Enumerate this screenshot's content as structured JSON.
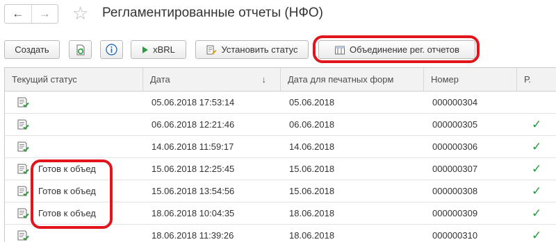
{
  "window": {
    "title": "Регламентированные отчеты (НФО)",
    "nav_back_icon": "arrow-left-icon",
    "nav_forward_icon": "arrow-right-icon",
    "favorite_icon": "star-icon"
  },
  "toolbar": {
    "create_label": "Создать",
    "xbrl_label": "xBRL",
    "set_status_label": "Установить статус",
    "merge_label": "Объединение рег. отчетов"
  },
  "table": {
    "columns": [
      "Текущий статус",
      "Дата",
      "Дата для печатных форм",
      "Номер",
      "Р."
    ],
    "sort_indicator": "↓",
    "rows": [
      {
        "status": "",
        "date": "05.06.2018 17:53:14",
        "print_date": "05.06.2018",
        "number": "000000304",
        "r": ""
      },
      {
        "status": "",
        "date": "06.06.2018 12:21:46",
        "print_date": "06.06.2018",
        "number": "000000305",
        "r": "✓"
      },
      {
        "status": "",
        "date": "14.06.2018 11:59:17",
        "print_date": "14.06.2018",
        "number": "000000306",
        "r": "✓"
      },
      {
        "status": "Готов к объед",
        "date": "15.06.2018 12:25:45",
        "print_date": "15.06.2018",
        "number": "000000307",
        "r": "✓"
      },
      {
        "status": "Готов к объед",
        "date": "15.06.2018 13:54:56",
        "print_date": "15.06.2018",
        "number": "000000308",
        "r": "✓"
      },
      {
        "status": "Готов к объед",
        "date": "18.06.2018 10:04:35",
        "print_date": "18.06.2018",
        "number": "000000309",
        "r": "✓"
      },
      {
        "status": "",
        "date": "18.06.2018 11:39:26",
        "print_date": "18.06.2018",
        "number": "000000310",
        "r": "✓"
      }
    ]
  },
  "colors": {
    "highlight": "#e2151d",
    "check": "#1c9a3c",
    "header_bg": "#f2f2f2"
  }
}
